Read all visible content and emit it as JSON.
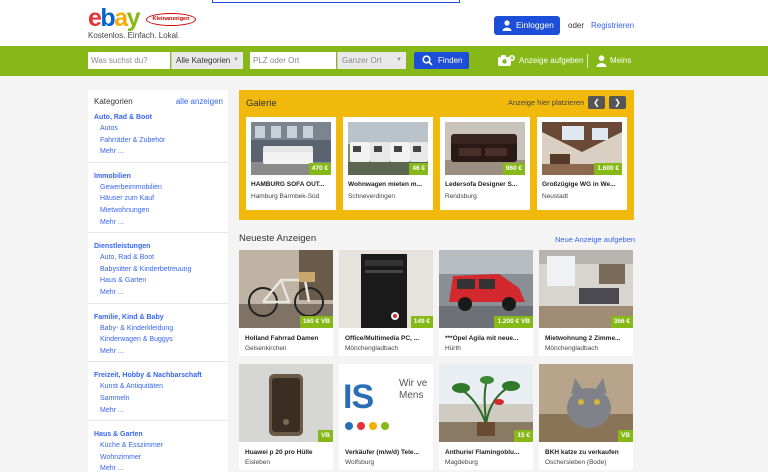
{
  "header": {
    "logo_letters": [
      "e",
      "b",
      "a",
      "y"
    ],
    "logo_badge": "Kleinanzeigen",
    "tagline": "Kostenlos. Einfach. Lokal.",
    "login_label": "Einloggen",
    "or_text": "oder",
    "register_label": "Registrieren"
  },
  "search": {
    "query_placeholder": "Was suchst du?",
    "category_value": "Alle Kategorien",
    "location_placeholder": "PLZ oder Ort",
    "radius_value": "Ganzer Ort",
    "find_label": "Finden",
    "post_ad_label": "Anzeige aufgeben",
    "my_label": "Meins"
  },
  "sidebar": {
    "heading": "Kategorien",
    "all_label": "alle anzeigen",
    "categories": [
      {
        "title": "Auto, Rad & Boot",
        "items": [
          "Autos",
          "Fahrräder & Zubehör",
          "Mehr ..."
        ]
      },
      {
        "title": "Immobilien",
        "items": [
          "Gewerbeimmobilien",
          "Häuser zum Kauf",
          "Mietwohnungen",
          "Mehr ..."
        ]
      },
      {
        "title": "Dienstleistungen",
        "items": [
          "Auto, Rad & Boot",
          "Babysitter & Kinderbetreuung",
          "Haus & Garten",
          "Mehr ..."
        ]
      },
      {
        "title": "Familie, Kind & Baby",
        "items": [
          "Baby- & Kinderkleidung",
          "Kinderwagen & Buggys",
          "Mehr ..."
        ]
      },
      {
        "title": "Freizeit, Hobby & Nachbarschaft",
        "items": [
          "Kunst & Antiquitäten",
          "Sammeln",
          "Mehr ..."
        ]
      },
      {
        "title": "Haus & Garten",
        "items": [
          "Küche & Esszimmer",
          "Wohnzimmer",
          "Mehr ..."
        ]
      }
    ]
  },
  "gallery": {
    "title": "Galerie",
    "place_label": "Anzeige hier platzieren",
    "prev_label": "❮",
    "next_label": "❯",
    "items": [
      {
        "price": "470 €",
        "name": "HAMBURG SOFA OUT...",
        "location": "Hamburg Barmbek-Süd"
      },
      {
        "price": "46 €",
        "name": "Wohnwagen mieten m...",
        "location": "Schneverdingen"
      },
      {
        "price": "960 €",
        "name": "Ledersofa Designer S...",
        "location": "Rendsburg"
      },
      {
        "price": "1.600 €",
        "name": "Großzügige WG in We...",
        "location": "Neustadt"
      }
    ]
  },
  "newest": {
    "title": "Neueste Anzeigen",
    "post_link": "Neue Anzeige aufgeben",
    "items": [
      {
        "price": "160 € VB",
        "name": "Holland Fahrrad Damen",
        "location": "Gelsenkirchen"
      },
      {
        "price": "149 €",
        "name": "Office/Multimedia PC, ...",
        "location": "Mönchengladbach"
      },
      {
        "price": "1.200 € VB",
        "name": "***Opel Agila mit neue...",
        "location": "Hürth"
      },
      {
        "price": "366 €",
        "name": "Mietwohnung 2 Zimme...",
        "location": "Mönchengladbach"
      },
      {
        "price": "VB",
        "name": "Huawei p 20 pro Hülle",
        "location": "Eisleben"
      },
      {
        "price": "",
        "name": "Verkäufer (m/w/d) Tele...",
        "location": "Wolfsburg",
        "banner_text": [
          "Wir ve",
          "Mens"
        ],
        "banner_logo": "IS"
      },
      {
        "price": "15 €",
        "name": "Anthurie/ Flamingoblu...",
        "location": "Magdeburg"
      },
      {
        "price": "VB",
        "name": "BKH katze zu verkaufen",
        "location": "Oschersleben (Bode)"
      }
    ]
  },
  "colors": {
    "brand_green": "#86b817",
    "brand_blue": "#1d4ed8",
    "gallery_yellow": "#f0b90b",
    "link_blue": "#3665f3"
  }
}
